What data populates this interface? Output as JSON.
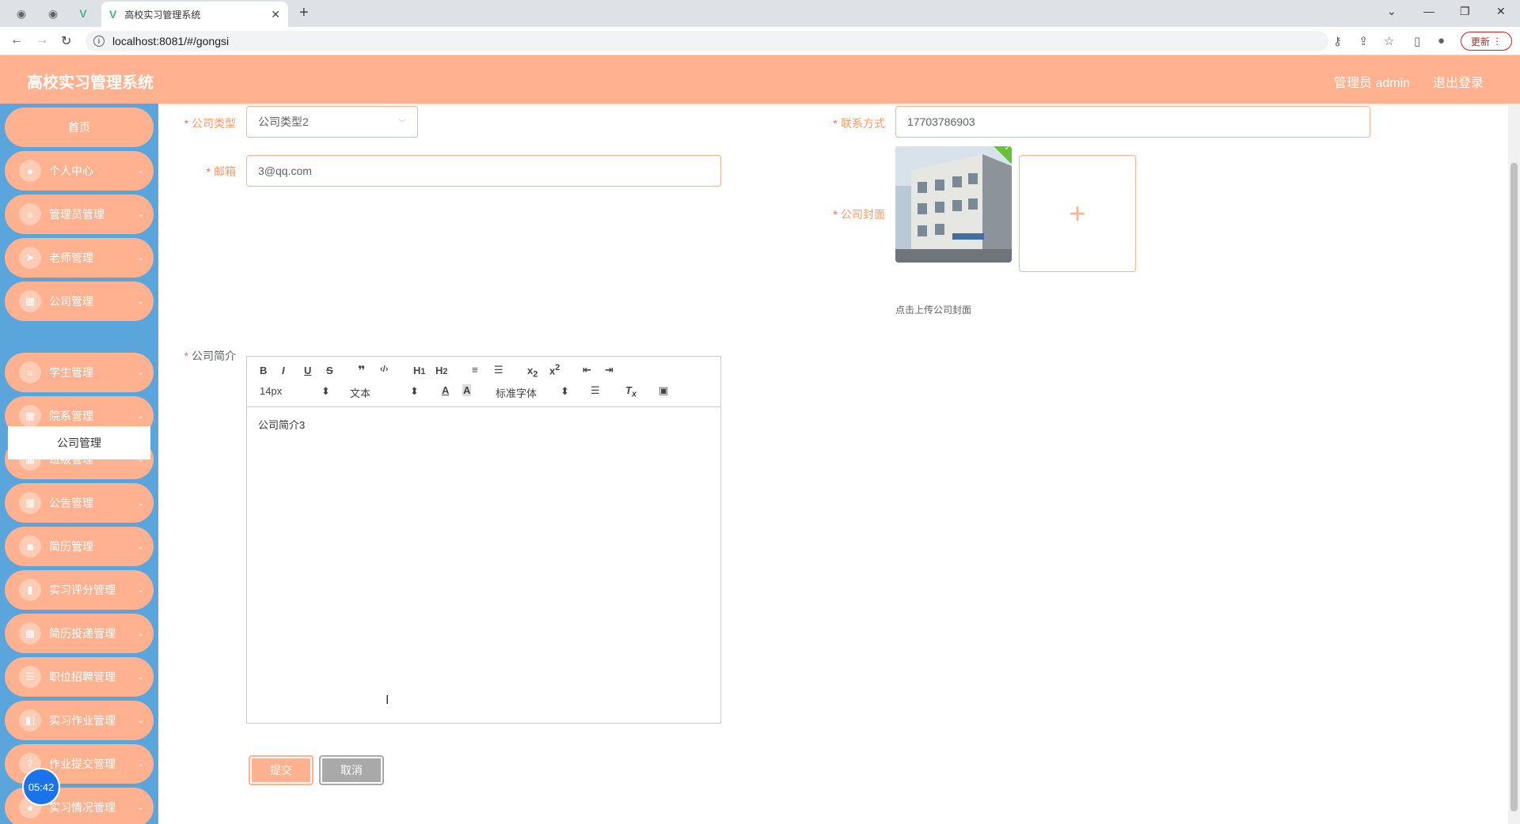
{
  "browser": {
    "tab_title": "高校实习管理系统",
    "url": "localhost:8081/#/gongsi",
    "update_label": "更新"
  },
  "header": {
    "title": "高校实习管理系统",
    "admin": "管理员 admin",
    "logout": "退出登录"
  },
  "sidebar": {
    "home": "首页",
    "items": [
      {
        "label": "个人中心",
        "icon": "user-icon"
      },
      {
        "label": "管理员管理",
        "icon": "list-icon"
      },
      {
        "label": "老师管理",
        "icon": "send-icon"
      },
      {
        "label": "公司管理",
        "icon": "grid-icon"
      },
      {
        "label": "学生管理",
        "icon": "list-icon"
      },
      {
        "label": "院系管理",
        "icon": "grid-icon"
      },
      {
        "label": "班级管理",
        "icon": "grid-icon"
      },
      {
        "label": "公告管理",
        "icon": "grid-icon"
      },
      {
        "label": "简历管理",
        "icon": "camera-icon"
      },
      {
        "label": "实习评分管理",
        "icon": "chart-icon"
      },
      {
        "label": "简历投递管理",
        "icon": "grid-icon"
      },
      {
        "label": "职位招聘管理",
        "icon": "sliders-icon"
      },
      {
        "label": "实习作业管理",
        "icon": "ticket-icon"
      },
      {
        "label": "作业提交管理",
        "icon": "upload-icon"
      },
      {
        "label": "实习情况管理",
        "icon": "user-icon"
      }
    ],
    "sub_active": "公司管理",
    "clock": "05:42"
  },
  "form": {
    "type_label": "公司类型",
    "type_value": "公司类型2",
    "contact_label": "联系方式",
    "contact_value": "17703786903",
    "email_label": "邮箱",
    "email_value": "3@qq.com",
    "cover_label": "公司封面",
    "cover_tip": "点击上传公司封面",
    "intro_label": "公司简介",
    "editor": {
      "font_size": "14px",
      "text_format": "文本",
      "font_family": "标准字体",
      "content": "公司简介3"
    },
    "submit": "提交",
    "cancel": "取消"
  }
}
